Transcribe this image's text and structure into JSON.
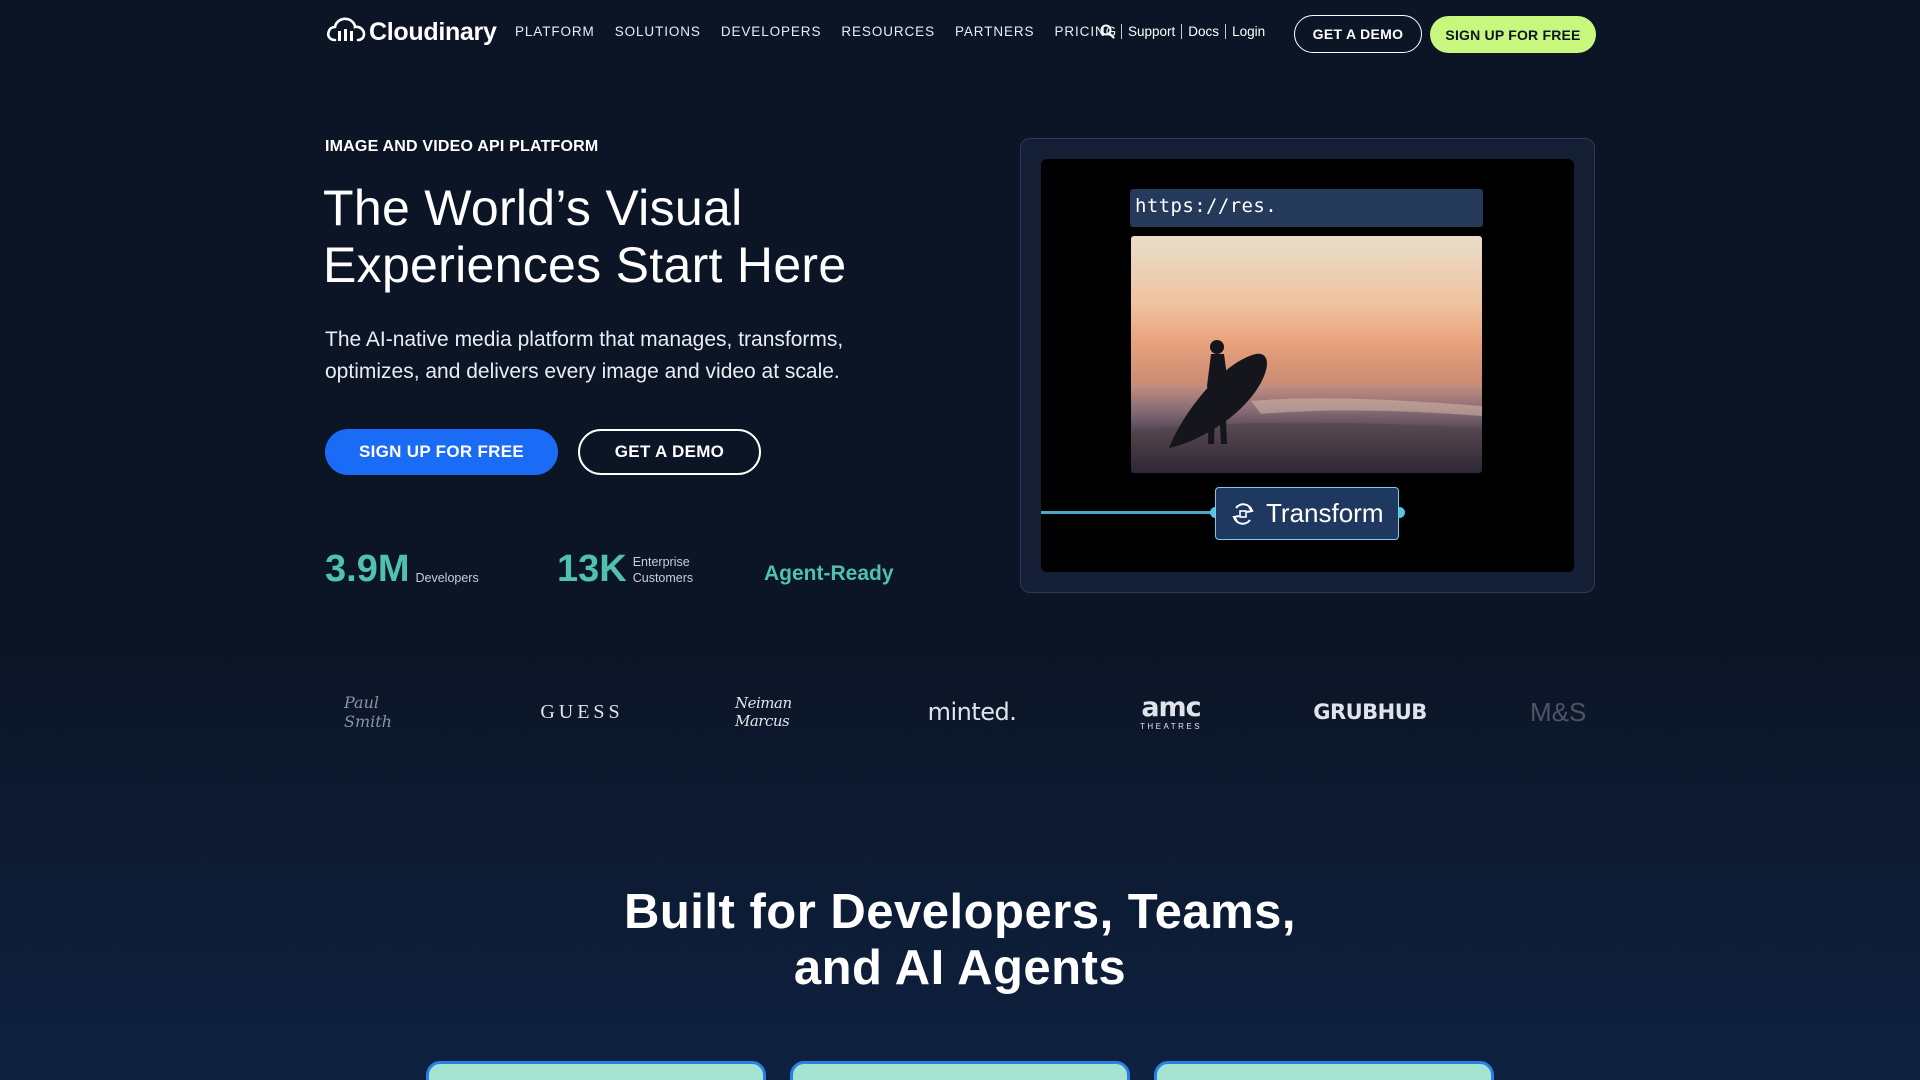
{
  "header": {
    "brand": "Cloudinary",
    "nav": [
      "PLATFORM",
      "SOLUTIONS",
      "DEVELOPERS",
      "RESOURCES",
      "PARTNERS",
      "PRICING"
    ],
    "utility": {
      "support": "Support",
      "docs": "Docs",
      "login": "Login"
    },
    "demo_label": "GET A DEMO",
    "signup_label": "SIGN UP FOR FREE"
  },
  "hero": {
    "eyebrow": "IMAGE AND VIDEO API PLATFORM",
    "title_line1": "The World’s Visual",
    "title_line2": "Experiences Start Here",
    "subtitle_line1": "The AI-native media platform that manages, transforms,",
    "subtitle_line2": "optimizes, and delivers every image and video at scale.",
    "primary_cta": "SIGN UP FOR FREE",
    "secondary_cta": "GET A DEMO",
    "stats": [
      {
        "value": "3.9M",
        "label_line1": "Developers",
        "label_line2": ""
      },
      {
        "value": "13K",
        "label_line1": "Enterprise",
        "label_line2": "Customers"
      }
    ],
    "agent_ready": "Agent-Ready"
  },
  "demo": {
    "url": "https://res.",
    "transform_label": "Transform"
  },
  "customer_logos": {
    "paul_smith": "Paul Smith",
    "guess": "GUESS",
    "neiman_marcus": "Neiman Marcus",
    "minted": "minted.",
    "amc_big": "amc",
    "amc_small": "THEATRES",
    "grubhub": "GRUBHUB",
    "ms": "M&S"
  },
  "section": {
    "title_line1": "Built for Developers, Teams,",
    "title_line2": "and AI Agents"
  },
  "colors": {
    "background": "#0c1526",
    "accent_teal": "#4fc1ac",
    "primary_blue": "#1a6bf5",
    "lime": "#c8f77e"
  },
  "icons": [
    "cloudinary-cloud-icon",
    "search-icon",
    "transform-icon"
  ]
}
